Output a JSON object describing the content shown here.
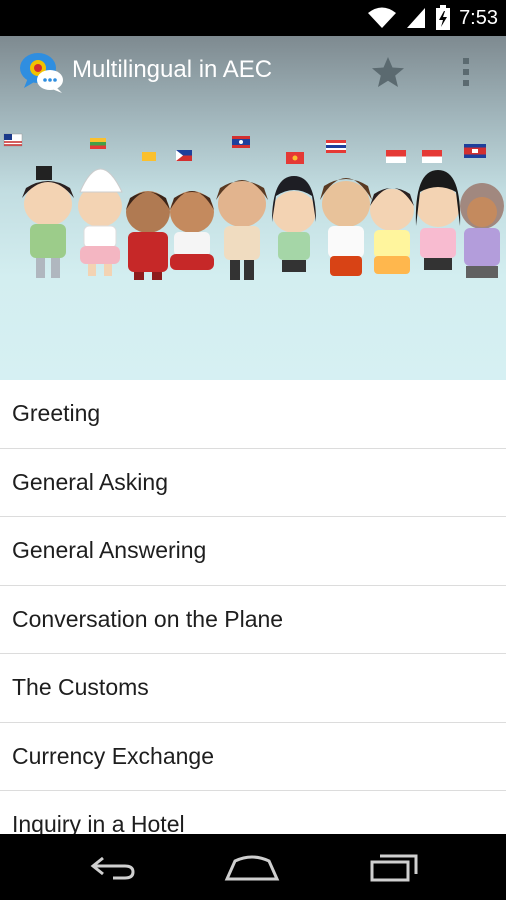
{
  "status_bar": {
    "time": "7:53",
    "icons": [
      "wifi-icon",
      "cell-signal-icon",
      "battery-charging-icon"
    ]
  },
  "action_bar": {
    "title": "Multilingual in AEC",
    "app_icon": "chat-bubbles-icon",
    "actions": [
      "star-icon",
      "overflow-menu-icon"
    ]
  },
  "colors": {
    "status_bar_bg": "#000000",
    "header_top": "#7e8a90",
    "banner_bg": "#d6f0f3",
    "list_bg": "#ffffff",
    "divider": "#dcdcdc",
    "text": "#1e1e1e"
  },
  "topics": [
    "Greeting",
    "General Asking",
    "General Answering",
    "Conversation on the Plane",
    "The Customs",
    "Currency Exchange",
    "Inquiry in a Hotel"
  ],
  "nav_bar": {
    "buttons": [
      "back-icon",
      "home-icon",
      "recent-apps-icon"
    ]
  }
}
